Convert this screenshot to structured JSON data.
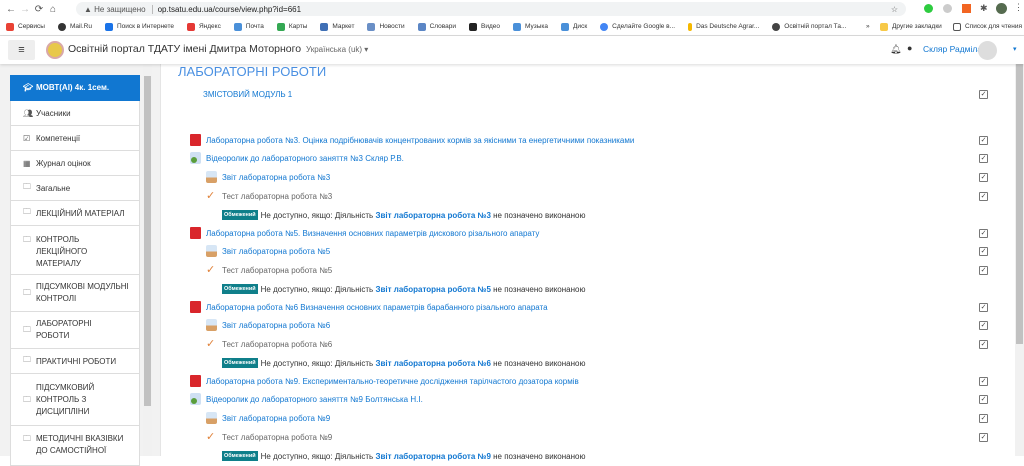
{
  "browser": {
    "security": "Не защищено",
    "url": "op.tsatu.edu.ua/course/view.php?id=661",
    "bookmarks": [
      {
        "label": "Сервисы",
        "color": "#e94235"
      },
      {
        "label": "Mail.Ru",
        "color": "#333"
      },
      {
        "label": "Поиск в Интернете",
        "color": "#1a73e8"
      },
      {
        "label": "Яндекс",
        "color": "#e53935"
      },
      {
        "label": "Почта",
        "color": "#4a90d9"
      },
      {
        "label": "Карты",
        "color": "#34a853"
      },
      {
        "label": "Маркет",
        "color": "#3f6fb5"
      },
      {
        "label": "Новости",
        "color": "#6a8fc6"
      },
      {
        "label": "Словари",
        "color": "#5b86c5"
      },
      {
        "label": "Видео",
        "color": "#222"
      },
      {
        "label": "Музыка",
        "color": "#4a90d9"
      },
      {
        "label": "Диск",
        "color": "#4a90d9"
      },
      {
        "label": "Сделайте Google в...",
        "color": "#4285f4"
      },
      {
        "label": "Das Deutsche Agrar...",
        "color": "#f5b800"
      },
      {
        "label": "Освітній портал Та...",
        "color": "#444"
      }
    ],
    "other_bookmarks": "Другие закладки",
    "reading_list": "Список для чтения"
  },
  "header": {
    "site_name": "Освітній портал ТДАТУ імені Дмитра Моторного",
    "language": "Українська (uk)",
    "user_name": "Скляр Радміла"
  },
  "sidebar": {
    "course": "МОВТ(АІ) 4к. 1сем.",
    "items": [
      {
        "label": "Учасники",
        "icon": "users-icon"
      },
      {
        "label": "Компетенції",
        "icon": "checkbox-icon"
      },
      {
        "label": "Журнал оцінок",
        "icon": "table-icon"
      },
      {
        "label": "Загальне",
        "icon": "folder-icon"
      },
      {
        "label": "ЛЕКЦІЙНИЙ МАТЕРІАЛ",
        "icon": "folder-icon"
      },
      {
        "label": "КОНТРОЛЬ ЛЕКЦІЙНОГО МАТЕРІАЛУ",
        "icon": "folder-icon"
      },
      {
        "label": "ПІДСУМКОВІ МОДУЛЬНІ КОНТРОЛІ",
        "icon": "folder-icon"
      },
      {
        "label": "ЛАБОРАТОРНІ РОБОТИ",
        "icon": "folder-icon"
      },
      {
        "label": "ПРАКТИЧНІ РОБОТИ",
        "icon": "folder-icon"
      },
      {
        "label": "ПІДСУМКОВИЙ КОНТРОЛЬ З ДИСЦИПЛІНИ",
        "icon": "folder-icon"
      },
      {
        "label": "МЕТОДИЧНІ ВКАЗІВКИ ДО САМОСТІЙНОЇ",
        "icon": "folder-icon"
      }
    ]
  },
  "main": {
    "section_title": "ЛАБОРАТОРНІ РОБОТИ",
    "module": "ЗМІСТОВИЙ МОДУЛЬ 1",
    "restriction": {
      "badge": "Обмежений",
      "prefix": "Не доступно, якщо: Діяльність",
      "suffix": "не позначено виконаною"
    },
    "activities": [
      {
        "type": "pdf",
        "label": "Лабораторна робота №3. Оцінка подрібнювачів концентрованих кормів за якісними та енергетичними показниками"
      },
      {
        "type": "video",
        "label": "Відеоролик до лабораторного заняття №3 Скляр Р.В."
      },
      {
        "type": "assign",
        "label": "Звіт лабораторна робота №3"
      },
      {
        "type": "quiz",
        "label": "Тест лабораторна робота №3",
        "restricted_by": "Звіт лабораторна робота №3"
      },
      {
        "type": "pdf",
        "label": "Лабораторна робота №5. Визначення основних параметрів дискового різального апарату"
      },
      {
        "type": "assign",
        "label": "Звіт лабораторна робота №5"
      },
      {
        "type": "quiz",
        "label": "Тест лабораторна робота №5",
        "restricted_by": "Звіт лабораторна робота №5"
      },
      {
        "type": "pdf",
        "label": "Лабораторна робота №6 Визначення основних параметрів барабанного різального апарата"
      },
      {
        "type": "assign",
        "label": "Звіт лабораторна робота №6"
      },
      {
        "type": "quiz",
        "label": "Тест лабораторна робота №6",
        "restricted_by": "Звіт лабораторна робота №6"
      },
      {
        "type": "pdf",
        "label": "Лабораторна робота №9. Експериментально-теоретичне дослідження тарілчастого дозатора кормів"
      },
      {
        "type": "video",
        "label": "Відеоролик до лабораторного заняття №9 Болтянська Н.І."
      },
      {
        "type": "assign",
        "label": "Звіт лабораторна робота №9"
      },
      {
        "type": "quiz",
        "label": "Тест лабораторна робота №9",
        "restricted_by": "Звіт лабораторна робота №9"
      }
    ]
  }
}
